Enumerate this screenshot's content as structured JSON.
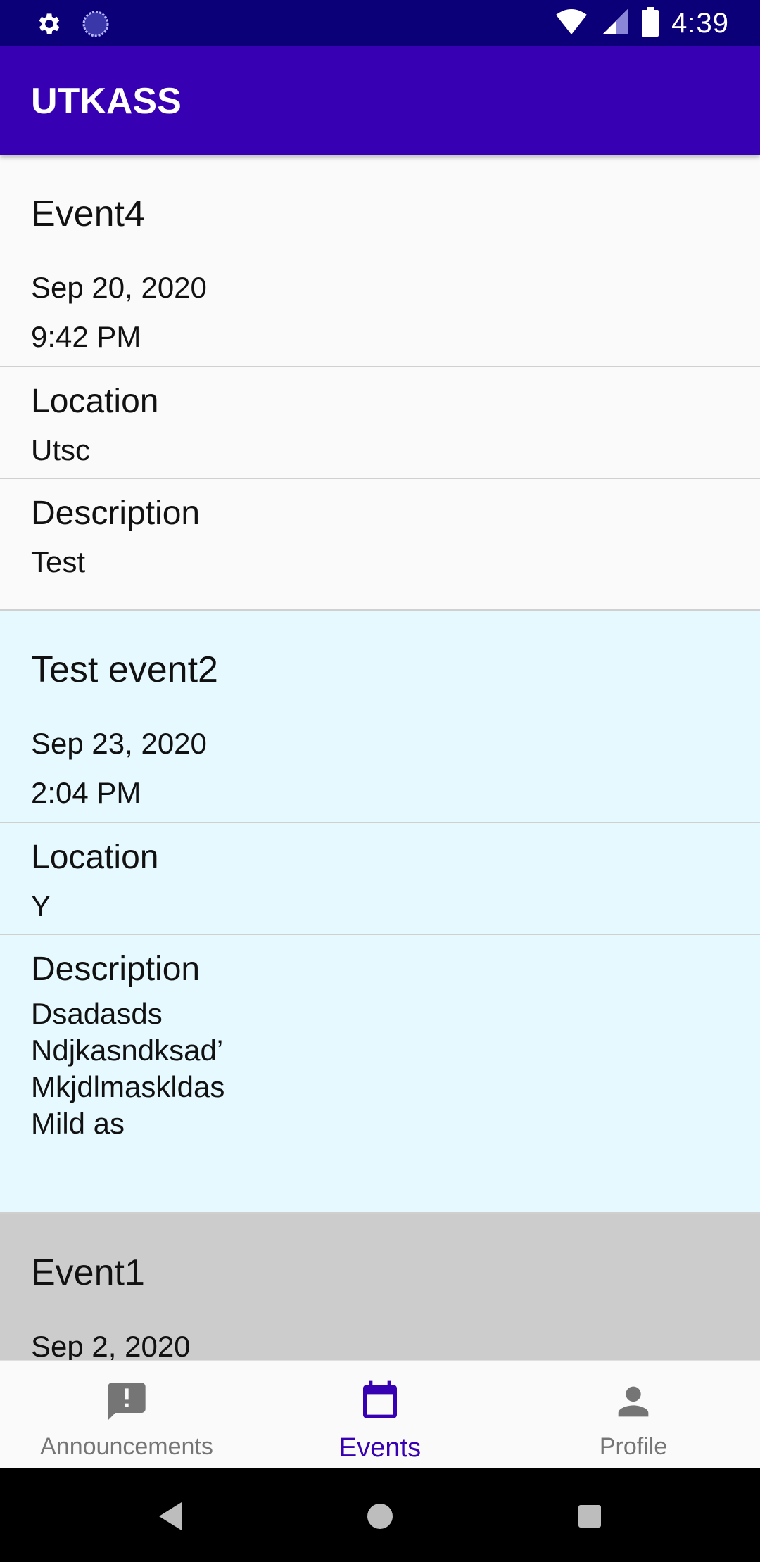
{
  "status_bar": {
    "time": "4:39",
    "icons_left": [
      "settings-icon",
      "loading-icon"
    ],
    "icons_right": [
      "wifi-icon",
      "signal-icon",
      "battery-icon"
    ]
  },
  "app_bar": {
    "title": "UTKASS"
  },
  "events": [
    {
      "title": "Event4",
      "date": "Sep 20, 2020",
      "time": "9:42 PM",
      "location_label": "Location",
      "location": "Utsc",
      "description_label": "Description",
      "description_lines": [
        "Test"
      ],
      "background": "#fafafa"
    },
    {
      "title": "Test event2",
      "date": "Sep 23, 2020",
      "time": "2:04 PM",
      "location_label": "Location",
      "location": "Y",
      "description_label": "Description",
      "description_lines": [
        "Dsadasds",
        "Ndjkasndksad’",
        "Mkjdlmaskldas",
        "Mild as"
      ],
      "background": "#e6f9ff"
    },
    {
      "title": "Event1",
      "date": "Sep 2, 2020",
      "background": "#cccccc"
    }
  ],
  "bottom_nav": {
    "items": [
      {
        "label": "Announcements",
        "icon": "announcement-icon",
        "active": false
      },
      {
        "label": "Events",
        "icon": "calendar-icon",
        "active": true
      },
      {
        "label": "Profile",
        "icon": "person-icon",
        "active": false
      }
    ]
  },
  "colors": {
    "status_bar": "#0c0078",
    "app_bar": "#3700b3",
    "accent": "#3700b3",
    "inactive": "#757575"
  },
  "system_nav": [
    "back-icon",
    "home-icon",
    "recents-icon"
  ]
}
